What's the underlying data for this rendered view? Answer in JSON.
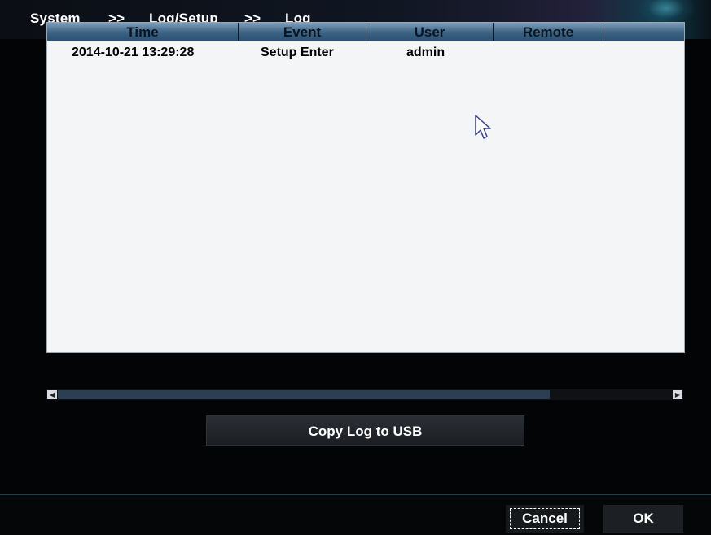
{
  "breadcrumb": {
    "items": [
      "System",
      "Log/Setup",
      "Log"
    ],
    "separator": ">>"
  },
  "log_table": {
    "columns": [
      "Time",
      "Event",
      "User",
      "Remote"
    ],
    "rows": [
      {
        "time": "2014-10-21 13:29:28",
        "event": "Setup Enter",
        "user": "admin",
        "remote": ""
      }
    ]
  },
  "actions": {
    "copy_label": "Copy Log to USB"
  },
  "footer": {
    "cancel_label": "Cancel",
    "ok_label": "OK"
  },
  "icons": {
    "scroll_left": "scroll-left-arrow-icon",
    "scroll_right": "scroll-right-arrow-icon",
    "pointer": "mouse-pointer-icon"
  },
  "colors": {
    "header_blue": "#3b6384",
    "table_bg": "#f4f5f6",
    "accent_teal": "#1f3f4a"
  }
}
